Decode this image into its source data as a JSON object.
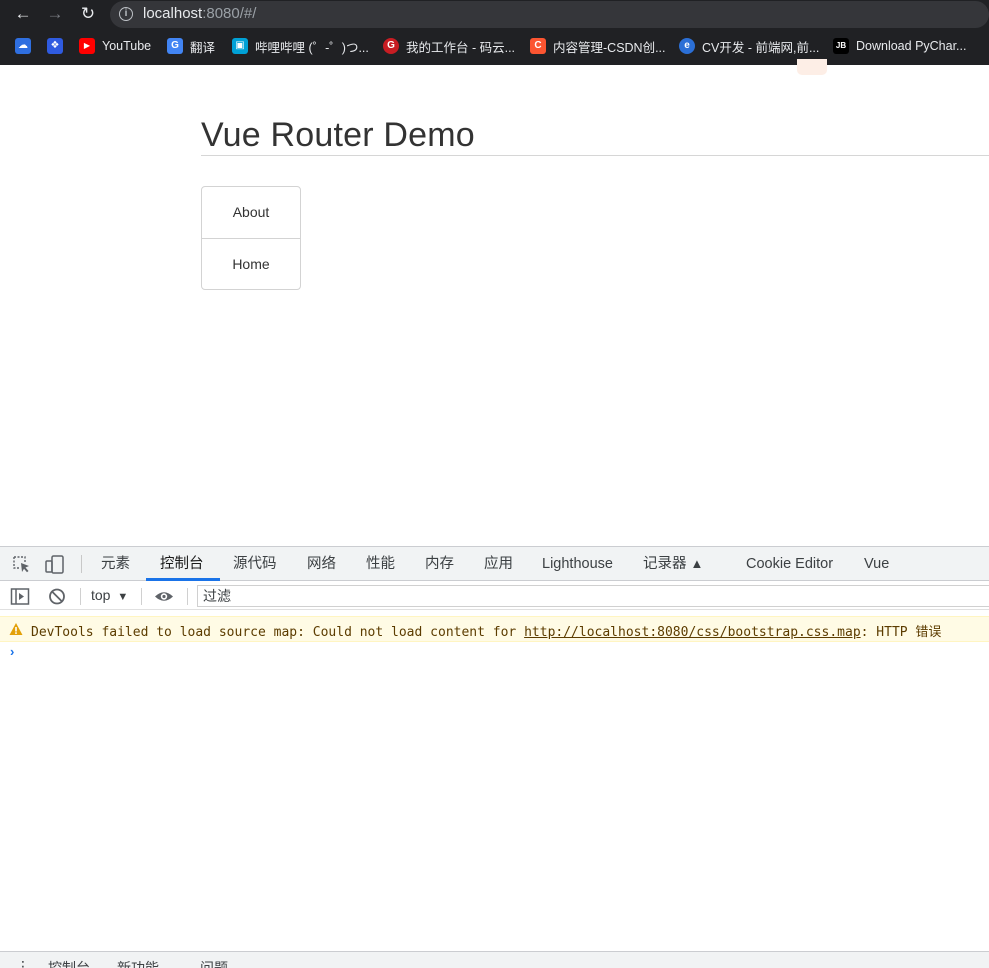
{
  "browser": {
    "url_host": "localhost",
    "url_rest": ":8080/#/",
    "bookmarks": [
      {
        "label": "",
        "icon": "baidu-cloud-icon",
        "color": "#2f6fe0"
      },
      {
        "label": "",
        "icon": "baidu-icon",
        "color": "#2f5be0"
      },
      {
        "label": "YouTube",
        "icon": "youtube-icon",
        "color": "#ff0000"
      },
      {
        "label": "翻译",
        "icon": "google-translate-icon",
        "color": "#4285f4"
      },
      {
        "label": "哔哩哔哩 (゜-゜)つ...",
        "icon": "bilibili-icon",
        "color": "#00a1d6"
      },
      {
        "label": "我的工作台 - 码云...",
        "icon": "gitee-icon",
        "color": "#c71d23"
      },
      {
        "label": "内容管理-CSDN创...",
        "icon": "csdn-icon",
        "color": "#fc5531"
      },
      {
        "label": "CV开发 - 前端网,前...",
        "icon": "cv-dev-icon",
        "color": "#2b6fd6"
      },
      {
        "label": "Download PyChar...",
        "icon": "jetbrains-icon",
        "color": "#000000"
      }
    ]
  },
  "page": {
    "title": "Vue Router Demo",
    "nav_links": [
      "About",
      "Home"
    ]
  },
  "devtools": {
    "tabs": [
      "元素",
      "控制台",
      "源代码",
      "网络",
      "性能",
      "内存",
      "应用",
      "Lighthouse",
      "记录器",
      "Cookie Editor",
      "Vue"
    ],
    "active_tab": "控制台",
    "context": "top",
    "filter_placeholder": "过滤",
    "warning": {
      "prefix": "DevTools failed to load source map: Could not load content for ",
      "link": "http://localhost:8080/css/bootstrap.css.map",
      "suffix": ": HTTP 错误"
    },
    "prompt_symbol": "›",
    "drawer_tabs": [
      "控制台",
      "新功能",
      "问题"
    ]
  }
}
